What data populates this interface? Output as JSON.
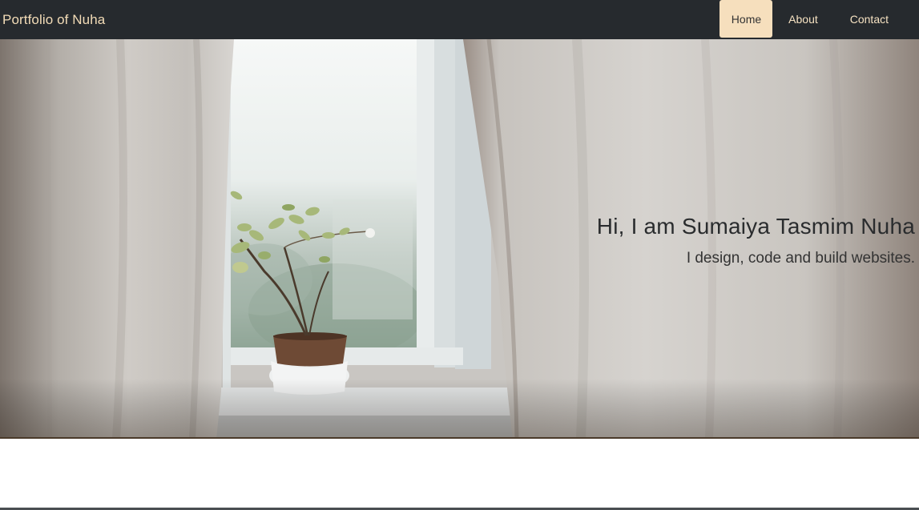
{
  "navbar": {
    "brand": "Portfolio of Nuha",
    "links": [
      {
        "label": "Home",
        "active": true
      },
      {
        "label": "About",
        "active": false
      },
      {
        "label": "Contact",
        "active": false
      }
    ]
  },
  "hero": {
    "title": "Hi, I am Sumaiya Tasmim Nuha",
    "subtitle": "I design, code and build websites."
  },
  "colors": {
    "navbar_bg": "#262a2e",
    "brand_text": "#f3dcb7",
    "active_link_bg": "#f6dfbd"
  }
}
